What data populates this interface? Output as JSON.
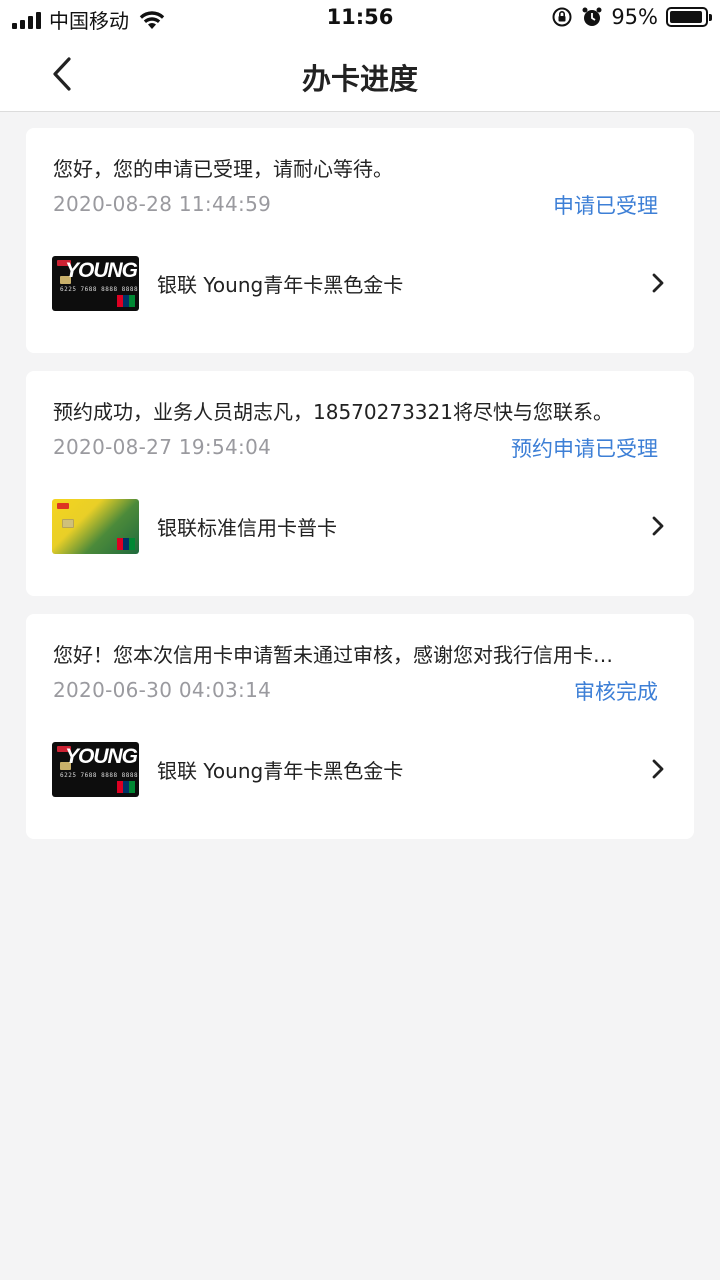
{
  "status_bar": {
    "carrier": "中国移动",
    "time": "11:56",
    "battery": "95%",
    "battery_level": 0.95
  },
  "nav": {
    "title": "办卡进度",
    "back_icon": "chevron-left-icon"
  },
  "applications": [
    {
      "message": "您好，您的申请已受理，请耐心等待。",
      "date": "2020-08-28 11:44:59",
      "status": "申请已受理",
      "card_name": "银联 Young青年卡黑色金卡",
      "card_type": "young-black",
      "card_number": "6225 7688 8888 8888"
    },
    {
      "message": "预约成功，业务人员胡志凡，18570273321将尽快与您联系。",
      "date": "2020-08-27 19:54:04",
      "status": "预约申请已受理",
      "card_name": "银联标准信用卡普卡",
      "card_type": "standard-yellow"
    },
    {
      "message": "您好！您本次信用卡申请暂未通过审核，感谢您对我行信用卡…",
      "date": "2020-06-30 04:03:14",
      "status": "审核完成",
      "card_name": "银联 Young青年卡黑色金卡",
      "card_type": "young-black",
      "card_number": "6225 7688 8888 8888"
    }
  ],
  "colors": {
    "background": "#f4f4f5",
    "card": "#ffffff",
    "status_blue": "#3d7fd6",
    "date_gray": "#9a9a9f"
  }
}
